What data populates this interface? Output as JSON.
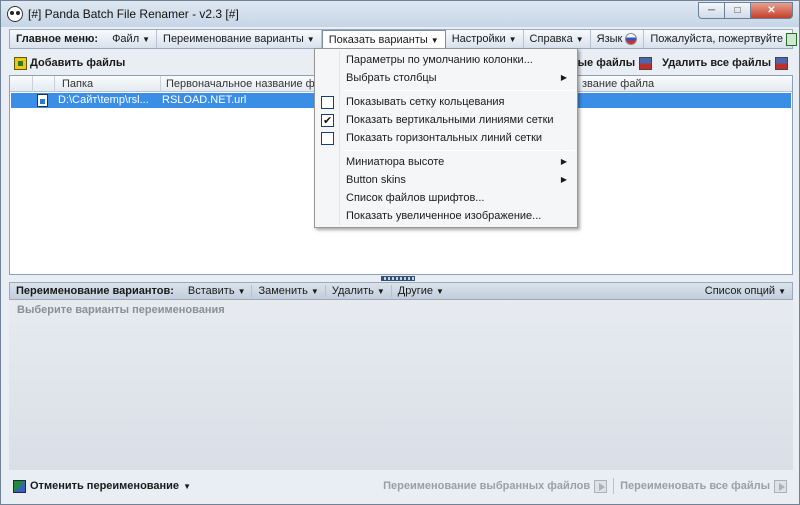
{
  "window": {
    "title": "[#] Panda Batch File Renamer - v2.3 [#]",
    "controls": {
      "minimize": "─",
      "maximize": "□",
      "close": "✕"
    }
  },
  "menubar": {
    "label": "Главное меню:",
    "items": [
      {
        "label": "Файл"
      },
      {
        "label": "Переименование варианты"
      },
      {
        "label": "Показать варианты"
      },
      {
        "label": "Настройки"
      },
      {
        "label": "Справка"
      }
    ],
    "language": "Язык",
    "donate": "Пожалуйста, пожертвуйте"
  },
  "toolbar": {
    "add_files": "Добавить файлы",
    "remove_selected": "ые файлы",
    "remove_all": "Удалить все файлы"
  },
  "file_list": {
    "columns": [
      "Папка",
      "Первоначальное название фа",
      "звание файла"
    ],
    "rows": [
      {
        "folder": "D:\\Сайт\\temp\\rsl...",
        "original_name": "RSLOAD.NET.url"
      }
    ]
  },
  "variants_bar": {
    "label": "Переименование вариантов:",
    "items": [
      {
        "label": "Вставить"
      },
      {
        "label": "Заменить"
      },
      {
        "label": "Удалить"
      },
      {
        "label": "Другие"
      }
    ],
    "options": "Список опций"
  },
  "variants_panel": {
    "hint": "Выберите варианты переименования"
  },
  "statusbar": {
    "undo": "Отменить переименование",
    "rename_selected": "Переименование выбранных файлов",
    "rename_all": "Переименовать все файлы"
  },
  "dropdown": {
    "items": [
      {
        "label": "Параметры по умолчанию колонки...",
        "has_check": false,
        "checked": false,
        "submenu": false
      },
      {
        "label": "Выбрать столбцы",
        "has_check": false,
        "checked": false,
        "submenu": true
      },
      {
        "label": "Показывать сетку кольцевания",
        "has_check": true,
        "checked": false,
        "submenu": false
      },
      {
        "label": "Показать вертикальными линиями сетки",
        "has_check": true,
        "checked": true,
        "submenu": false
      },
      {
        "label": "Показать горизонтальных линий сетки",
        "has_check": true,
        "checked": false,
        "submenu": false
      },
      {
        "label": "Миниатюра высоте",
        "has_check": false,
        "checked": false,
        "submenu": true
      },
      {
        "label": "Button skins",
        "has_check": false,
        "checked": false,
        "submenu": true
      },
      {
        "label": "Список файлов шрифтов...",
        "has_check": false,
        "checked": false,
        "submenu": false
      },
      {
        "label": "Показать увеличенное изображение...",
        "has_check": false,
        "checked": false,
        "submenu": false
      }
    ]
  }
}
